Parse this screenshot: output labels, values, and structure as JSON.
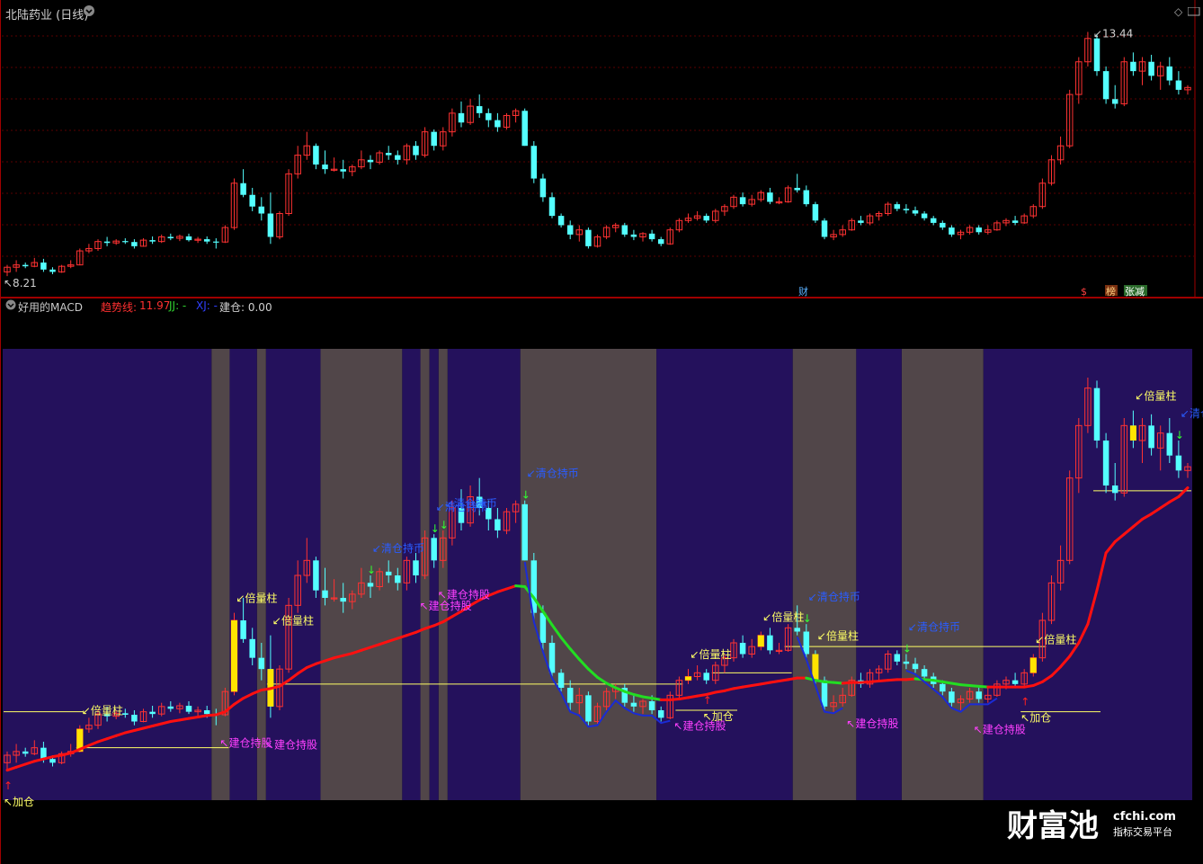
{
  "window": {
    "stock_title": "北陆药业 (日线)",
    "indicator_title": "好用的MACD",
    "trend_label": "趋势线:",
    "trend_value": "11.97",
    "jj_label": "JJ: -",
    "xj_label": "XJ: -",
    "build_label": "建仓: 0.00",
    "max_price": "13.44",
    "min_price": "8.21",
    "event_cai": "财",
    "event_s": "$",
    "event_bang": "榜",
    "event_zhangjian": "张减"
  },
  "watermark": {
    "brand": "财富池",
    "site": "cfchi.com",
    "slogan": "指标交易平台"
  },
  "colors": {
    "up": "#ff3232",
    "down": "#54ffff",
    "panel_border": "#a00000",
    "bg_blue": "#24115c",
    "bg_gray": "#514649",
    "trend_red": "#ff1010",
    "trend_green": "#22dd22",
    "trend_blue": "#1a2bd6",
    "yellow_bar": "#ffe400",
    "line_yellow": "#ffff66",
    "text_blue": "#2a5cff",
    "text_magenta": "#ff40ff",
    "text_yellow": "#ffff66"
  },
  "chart_data": [
    {
      "type": "candlestick",
      "title": "北陆药业 (日线)",
      "x_index": [
        0,
        1,
        2,
        3,
        4,
        5,
        6,
        7,
        8,
        9,
        10,
        11,
        12,
        13,
        14,
        15,
        16,
        17,
        18,
        19,
        20,
        21,
        22,
        23,
        24,
        25,
        26,
        27,
        28,
        29,
        30,
        31,
        32,
        33,
        34,
        35,
        36,
        37,
        38,
        39,
        40,
        41,
        42,
        43,
        44,
        45,
        46,
        47,
        48,
        49,
        50,
        51,
        52,
        53,
        54,
        55,
        56,
        57,
        58,
        59,
        60,
        61,
        62,
        63,
        64,
        65,
        66,
        67,
        68,
        69,
        70,
        71,
        72,
        73,
        74,
        75,
        76,
        77,
        78,
        79,
        80,
        81,
        82,
        83,
        84,
        85,
        86,
        87,
        88,
        89,
        90,
        91,
        92,
        93,
        94,
        95,
        96,
        97,
        98,
        99,
        100,
        101,
        102,
        103,
        104,
        105,
        106,
        107,
        108,
        109,
        110,
        111,
        112,
        113,
        114,
        115,
        116,
        117,
        118,
        119,
        120,
        121,
        122,
        123,
        124,
        125,
        126,
        127,
        128,
        129,
        130
      ],
      "ohlc": [
        [
          8.3,
          8.45,
          8.21,
          8.4
        ],
        [
          8.4,
          8.55,
          8.3,
          8.45
        ],
        [
          8.45,
          8.5,
          8.38,
          8.42
        ],
        [
          8.42,
          8.6,
          8.4,
          8.5
        ],
        [
          8.5,
          8.58,
          8.3,
          8.35
        ],
        [
          8.35,
          8.4,
          8.25,
          8.3
        ],
        [
          8.3,
          8.45,
          8.28,
          8.42
        ],
        [
          8.42,
          8.55,
          8.38,
          8.45
        ],
        [
          8.45,
          8.8,
          8.44,
          8.75
        ],
        [
          8.75,
          8.9,
          8.7,
          8.8
        ],
        [
          8.8,
          9.0,
          8.75,
          8.95
        ],
        [
          8.95,
          9.05,
          8.85,
          8.92
        ],
        [
          8.92,
          9.0,
          8.88,
          8.96
        ],
        [
          8.96,
          9.02,
          8.9,
          8.94
        ],
        [
          8.94,
          9.0,
          8.8,
          8.85
        ],
        [
          8.85,
          9.02,
          8.84,
          8.98
        ],
        [
          8.98,
          9.06,
          8.9,
          8.95
        ],
        [
          8.95,
          9.1,
          8.92,
          9.05
        ],
        [
          9.05,
          9.12,
          8.98,
          9.02
        ],
        [
          9.02,
          9.1,
          8.96,
          9.06
        ],
        [
          9.06,
          9.12,
          8.95,
          8.98
        ],
        [
          8.98,
          9.05,
          8.92,
          9.0
        ],
        [
          9.0,
          9.06,
          8.9,
          8.95
        ],
        [
          8.95,
          9.02,
          8.8,
          8.94
        ],
        [
          8.94,
          9.3,
          8.92,
          9.25
        ],
        [
          9.25,
          10.3,
          9.2,
          10.2
        ],
        [
          10.2,
          10.5,
          9.9,
          9.95
        ],
        [
          9.95,
          10.1,
          9.6,
          9.7
        ],
        [
          9.7,
          9.9,
          9.4,
          9.55
        ],
        [
          9.55,
          10.0,
          8.9,
          9.05
        ],
        [
          9.05,
          9.6,
          9.0,
          9.55
        ],
        [
          9.55,
          10.5,
          9.5,
          10.4
        ],
        [
          10.4,
          11.0,
          10.3,
          10.8
        ],
        [
          10.8,
          11.3,
          10.7,
          11.0
        ],
        [
          11.0,
          11.05,
          10.5,
          10.6
        ],
        [
          10.6,
          10.9,
          10.4,
          10.5
        ],
        [
          10.5,
          10.75,
          10.45,
          10.5
        ],
        [
          10.5,
          10.7,
          10.3,
          10.45
        ],
        [
          10.45,
          10.6,
          10.35,
          10.55
        ],
        [
          10.55,
          10.9,
          10.5,
          10.7
        ],
        [
          10.7,
          10.8,
          10.5,
          10.65
        ],
        [
          10.65,
          10.9,
          10.6,
          10.85
        ],
        [
          10.85,
          11.0,
          10.7,
          10.8
        ],
        [
          10.8,
          10.9,
          10.6,
          10.7
        ],
        [
          10.7,
          11.05,
          10.6,
          11.0
        ],
        [
          11.0,
          11.1,
          10.7,
          10.8
        ],
        [
          10.8,
          11.4,
          10.75,
          11.3
        ],
        [
          11.3,
          11.35,
          10.9,
          11.0
        ],
        [
          11.0,
          11.4,
          10.9,
          11.3
        ],
        [
          11.3,
          11.8,
          11.2,
          11.7
        ],
        [
          11.7,
          11.95,
          11.4,
          11.5
        ],
        [
          11.5,
          12.0,
          11.45,
          11.85
        ],
        [
          11.85,
          12.1,
          11.6,
          11.7
        ],
        [
          11.7,
          11.8,
          11.4,
          11.55
        ],
        [
          11.55,
          11.7,
          11.3,
          11.4
        ],
        [
          11.4,
          11.7,
          11.35,
          11.65
        ],
        [
          11.65,
          11.8,
          11.5,
          11.75
        ],
        [
          11.75,
          11.8,
          11.0,
          11.0
        ],
        [
          11.0,
          11.1,
          10.2,
          10.3
        ],
        [
          10.3,
          10.4,
          9.8,
          9.9
        ],
        [
          9.9,
          10.0,
          9.45,
          9.5
        ],
        [
          9.5,
          9.55,
          9.25,
          9.3
        ],
        [
          9.3,
          9.4,
          9.0,
          9.1
        ],
        [
          9.1,
          9.3,
          8.95,
          9.2
        ],
        [
          9.2,
          9.25,
          8.8,
          8.85
        ],
        [
          8.85,
          9.1,
          8.82,
          9.05
        ],
        [
          9.05,
          9.3,
          9.0,
          9.25
        ],
        [
          9.25,
          9.35,
          9.15,
          9.3
        ],
        [
          9.3,
          9.35,
          9.05,
          9.1
        ],
        [
          9.1,
          9.2,
          8.98,
          9.05
        ],
        [
          9.05,
          9.15,
          8.95,
          9.12
        ],
        [
          9.12,
          9.2,
          8.95,
          9.0
        ],
        [
          9.0,
          9.05,
          8.85,
          8.9
        ],
        [
          8.9,
          9.25,
          8.88,
          9.2
        ],
        [
          9.2,
          9.45,
          9.15,
          9.4
        ],
        [
          9.4,
          9.55,
          9.35,
          9.45
        ],
        [
          9.45,
          9.6,
          9.4,
          9.5
        ],
        [
          9.5,
          9.55,
          9.35,
          9.4
        ],
        [
          9.4,
          9.65,
          9.35,
          9.6
        ],
        [
          9.6,
          9.75,
          9.5,
          9.7
        ],
        [
          9.7,
          9.95,
          9.65,
          9.9
        ],
        [
          9.9,
          10.0,
          9.7,
          9.75
        ],
        [
          9.75,
          9.95,
          9.7,
          9.85
        ],
        [
          9.85,
          10.05,
          9.8,
          10.0
        ],
        [
          10.0,
          10.1,
          9.75,
          9.8
        ],
        [
          9.8,
          9.9,
          9.75,
          9.8
        ],
        [
          9.8,
          10.15,
          9.78,
          10.1
        ],
        [
          10.1,
          10.4,
          10.0,
          10.05
        ],
        [
          10.05,
          10.15,
          9.7,
          9.75
        ],
        [
          9.75,
          9.8,
          9.35,
          9.4
        ],
        [
          9.4,
          9.45,
          9.0,
          9.05
        ],
        [
          9.05,
          9.2,
          8.98,
          9.1
        ],
        [
          9.1,
          9.3,
          9.05,
          9.2
        ],
        [
          9.2,
          9.45,
          9.18,
          9.4
        ],
        [
          9.4,
          9.5,
          9.3,
          9.35
        ],
        [
          9.35,
          9.55,
          9.3,
          9.5
        ],
        [
          9.5,
          9.6,
          9.4,
          9.55
        ],
        [
          9.55,
          9.8,
          9.5,
          9.75
        ],
        [
          9.75,
          9.8,
          9.6,
          9.65
        ],
        [
          9.65,
          9.75,
          9.55,
          9.62
        ],
        [
          9.62,
          9.7,
          9.5,
          9.55
        ],
        [
          9.55,
          9.6,
          9.4,
          9.45
        ],
        [
          9.45,
          9.5,
          9.3,
          9.35
        ],
        [
          9.35,
          9.4,
          9.2,
          9.25
        ],
        [
          9.25,
          9.3,
          9.05,
          9.1
        ],
        [
          9.1,
          9.2,
          9.0,
          9.15
        ],
        [
          9.15,
          9.3,
          9.1,
          9.25
        ],
        [
          9.25,
          9.3,
          9.1,
          9.15
        ],
        [
          9.15,
          9.3,
          9.1,
          9.2
        ],
        [
          9.2,
          9.4,
          9.18,
          9.35
        ],
        [
          9.35,
          9.45,
          9.28,
          9.4
        ],
        [
          9.4,
          9.5,
          9.3,
          9.35
        ],
        [
          9.35,
          9.55,
          9.33,
          9.5
        ],
        [
          9.5,
          9.75,
          9.45,
          9.7
        ],
        [
          9.7,
          10.3,
          9.65,
          10.2
        ],
        [
          10.2,
          10.8,
          10.15,
          10.7
        ],
        [
          10.7,
          11.2,
          10.6,
          11.0
        ],
        [
          11.0,
          12.2,
          10.95,
          12.1
        ],
        [
          12.1,
          12.9,
          11.9,
          12.8
        ],
        [
          12.8,
          13.44,
          12.7,
          13.3
        ],
        [
          13.3,
          13.4,
          12.5,
          12.6
        ],
        [
          12.6,
          12.7,
          11.9,
          12.0
        ],
        [
          12.0,
          12.3,
          11.8,
          11.9
        ],
        [
          11.9,
          12.9,
          11.85,
          12.8
        ],
        [
          12.8,
          13.0,
          12.5,
          12.6
        ],
        [
          12.6,
          12.9,
          12.3,
          12.8
        ],
        [
          12.8,
          12.95,
          12.4,
          12.5
        ],
        [
          12.5,
          12.8,
          12.2,
          12.7
        ],
        [
          12.7,
          12.9,
          12.3,
          12.4
        ],
        [
          12.4,
          12.6,
          12.1,
          12.2
        ],
        [
          12.2,
          12.3,
          12.1,
          12.25
        ]
      ],
      "ylim": [
        8.0,
        13.7
      ]
    },
    {
      "type": "line",
      "title": "好用的MACD",
      "series": [
        {
          "name": "趋势线",
          "values": [
            8.2,
            8.24,
            8.28,
            8.32,
            8.35,
            8.38,
            8.4,
            8.43,
            8.48,
            8.53,
            8.58,
            8.62,
            8.66,
            8.7,
            8.73,
            8.76,
            8.79,
            8.82,
            8.85,
            8.87,
            8.89,
            8.91,
            8.93,
            8.94,
            8.98,
            9.08,
            9.16,
            9.22,
            9.27,
            9.29,
            9.32,
            9.4,
            9.49,
            9.57,
            9.62,
            9.66,
            9.7,
            9.73,
            9.76,
            9.8,
            9.84,
            9.88,
            9.92,
            9.96,
            10.0,
            10.04,
            10.09,
            10.13,
            10.18,
            10.25,
            10.32,
            10.4,
            10.47,
            10.53,
            10.58,
            10.62,
            10.66,
            10.65,
            10.5,
            10.32,
            10.14,
            9.97,
            9.82,
            9.68,
            9.55,
            9.44,
            9.36,
            9.3,
            9.25,
            9.21,
            9.18,
            9.16,
            9.14,
            9.14,
            9.15,
            9.17,
            9.19,
            9.21,
            9.24,
            9.26,
            9.29,
            9.31,
            9.33,
            9.35,
            9.37,
            9.39,
            9.41,
            9.43,
            9.43,
            9.4,
            9.38,
            9.37,
            9.36,
            9.37,
            9.37,
            9.38,
            9.39,
            9.4,
            9.41,
            9.41,
            9.42,
            9.41,
            9.4,
            9.38,
            9.36,
            9.34,
            9.33,
            9.32,
            9.31,
            9.31,
            9.31,
            9.31,
            9.31,
            9.33,
            9.38,
            9.46,
            9.58,
            9.72,
            9.9,
            10.15,
            10.6,
            11.1,
            11.25,
            11.35,
            11.45,
            11.55,
            11.62,
            11.7,
            11.78,
            11.85,
            11.97
          ]
        },
        {
          "name": "JJ",
          "values": []
        },
        {
          "name": "XJ",
          "values": []
        }
      ],
      "signals": {
        "倍量柱": [
          8,
          25,
          29,
          75,
          83,
          89,
          113,
          124
        ],
        "加仓": [
          0,
          77,
          112
        ],
        "建仓持股": [
          24,
          29,
          46,
          48,
          74,
          93,
          107
        ],
        "清仓持币": [
          40,
          47,
          48,
          57,
          88,
          99,
          129
        ]
      },
      "bands": {
        "gray": [
          [
            23,
            24
          ],
          [
            28,
            28
          ],
          [
            35,
            43
          ],
          [
            46,
            46
          ],
          [
            48,
            48
          ],
          [
            57,
            71
          ],
          [
            87,
            93
          ],
          [
            99,
            107
          ]
        ],
        "blue": [
          [
            0,
            22
          ],
          [
            25,
            27
          ],
          [
            29,
            34
          ],
          [
            44,
            45
          ],
          [
            47,
            47
          ],
          [
            49,
            56
          ],
          [
            72,
            86
          ],
          [
            94,
            98
          ],
          [
            108,
            130
          ]
        ]
      },
      "support_lines": [
        {
          "from": 0,
          "to": 8,
          "value": 8.98
        },
        {
          "from": 8,
          "to": 24,
          "value": 8.5
        },
        {
          "from": 29,
          "to": 74,
          "value": 9.35
        },
        {
          "from": 74,
          "to": 80,
          "value": 9.0
        },
        {
          "from": 78,
          "to": 86,
          "value": 9.5
        },
        {
          "from": 86,
          "to": 114,
          "value": 9.85
        },
        {
          "from": 112,
          "to": 120,
          "value": 8.98
        },
        {
          "from": 120,
          "to": 130,
          "value": 11.93
        }
      ],
      "ylim": [
        7.8,
        13.8
      ]
    }
  ]
}
